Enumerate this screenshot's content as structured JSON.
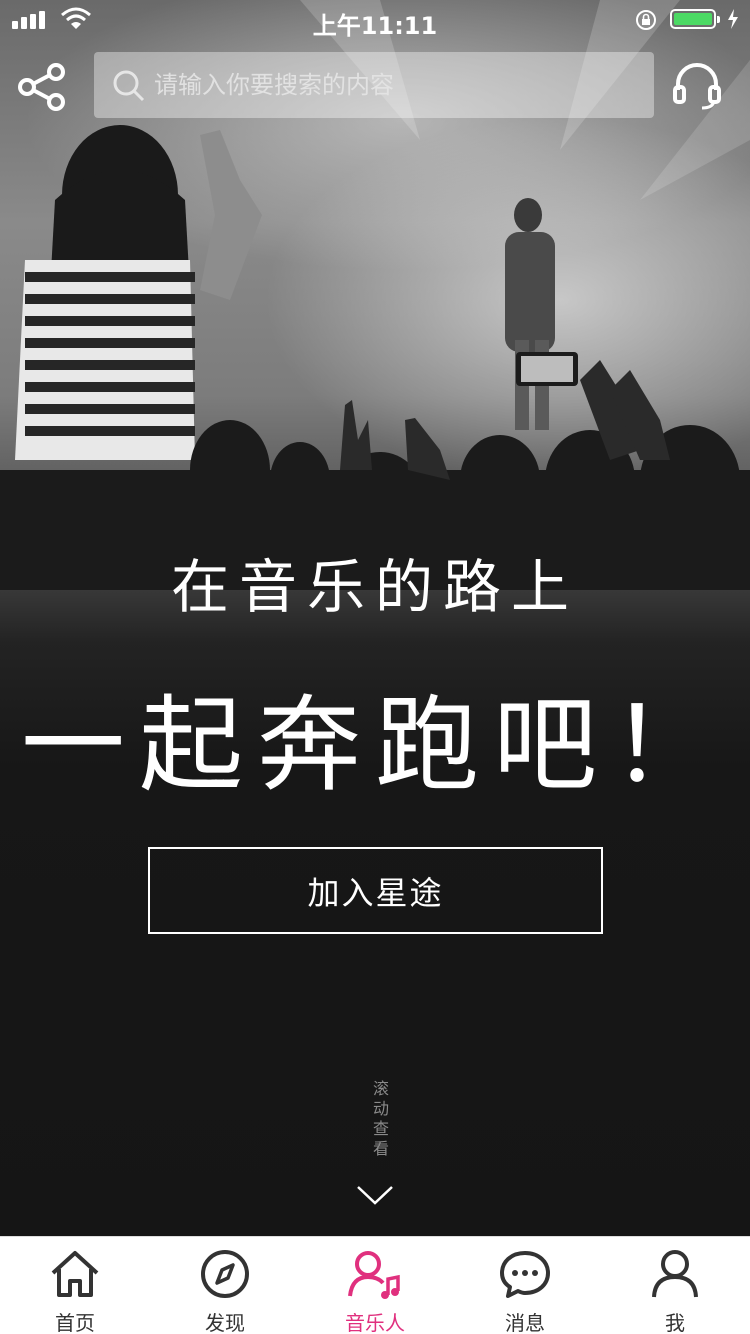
{
  "status_bar": {
    "time": "上午11:11"
  },
  "search": {
    "placeholder": "请输入你要搜索的内容"
  },
  "hero": {
    "line1": "在音乐的路上",
    "line2": "一起奔跑吧！",
    "join_label": "加入星途",
    "scroll_hint": "滚动查看"
  },
  "tabbar": {
    "active_color": "#e0307e",
    "items": [
      {
        "label": "首页",
        "icon": "home-icon"
      },
      {
        "label": "发现",
        "icon": "compass-icon"
      },
      {
        "label": "音乐人",
        "icon": "musician-icon",
        "active": true
      },
      {
        "label": "消息",
        "icon": "message-icon"
      },
      {
        "label": "我",
        "icon": "profile-icon"
      }
    ]
  }
}
